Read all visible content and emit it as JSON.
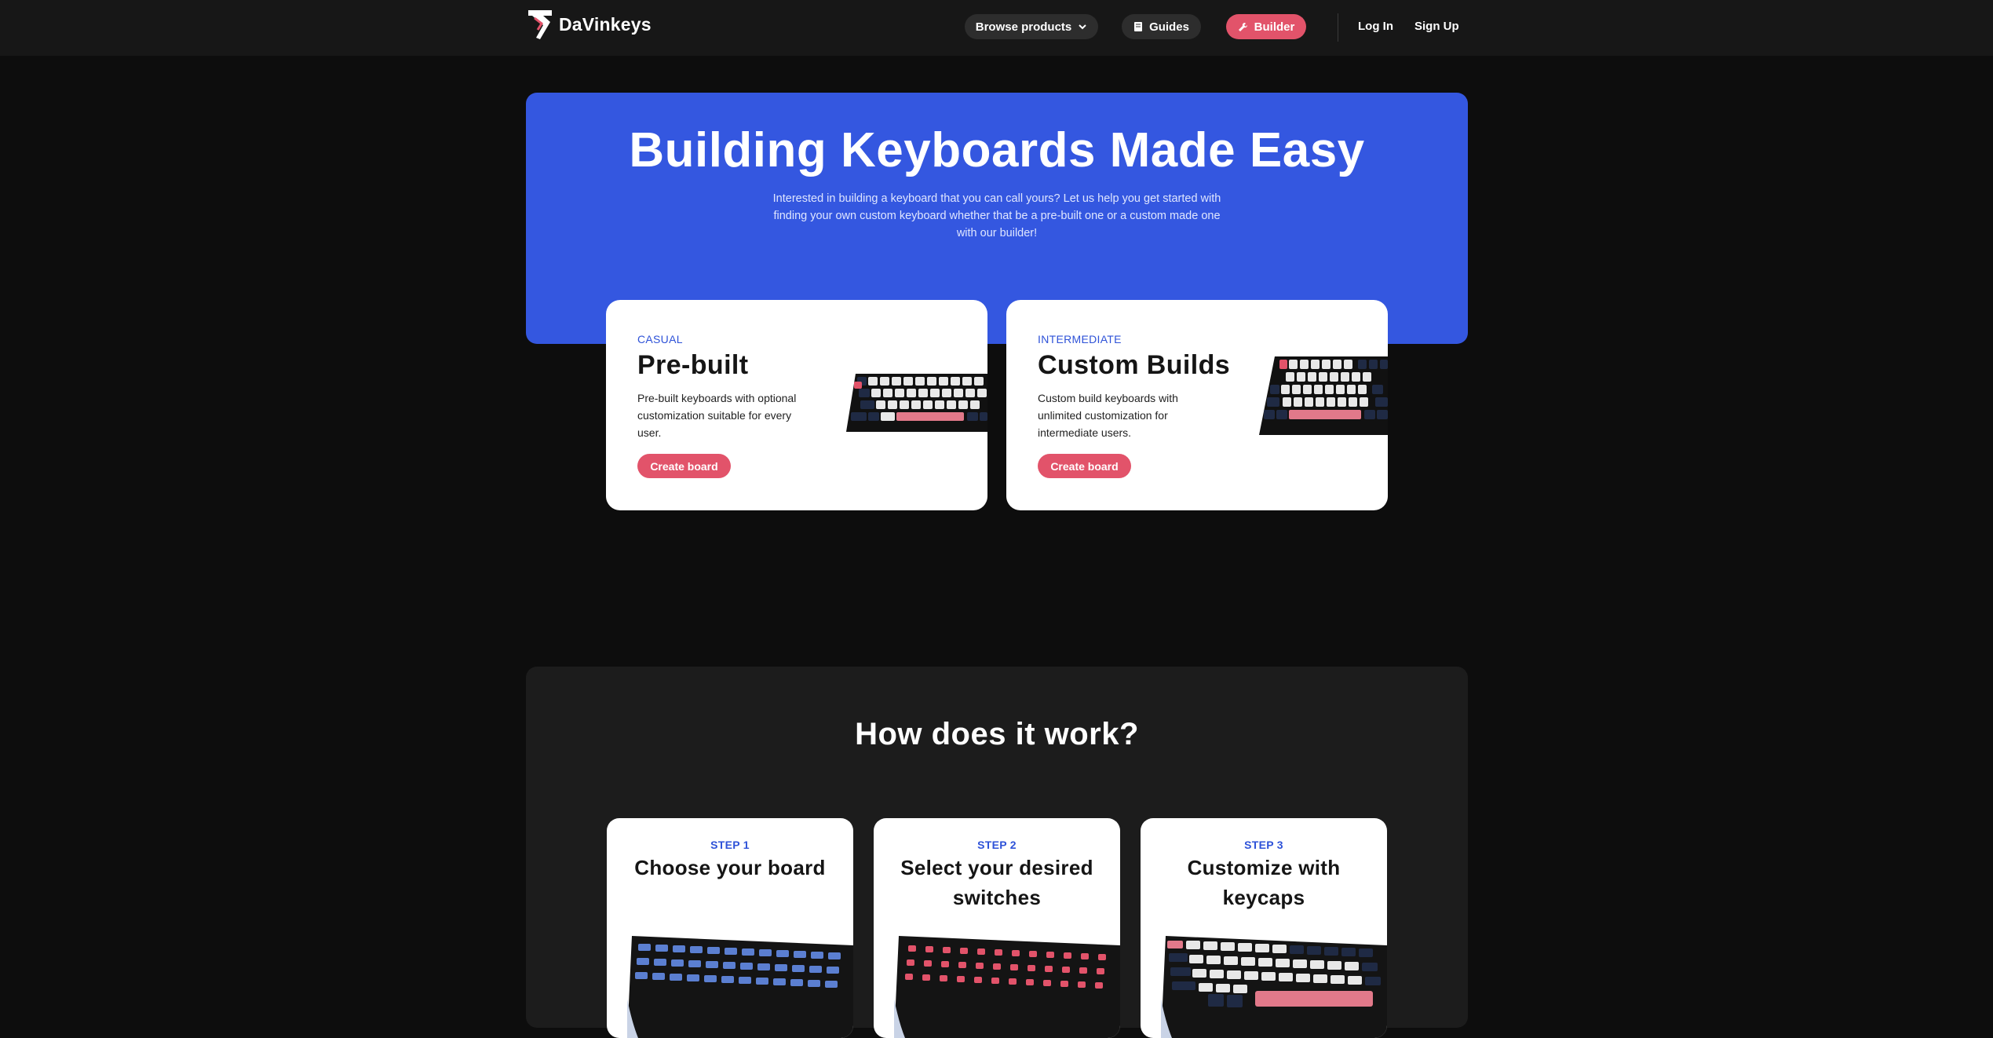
{
  "brand": {
    "name": "DaVinkeys"
  },
  "nav": {
    "browse_label": "Browse products",
    "guides_label": "Guides",
    "builder_label": "Builder",
    "login_label": "Log In",
    "signup_label": "Sign Up"
  },
  "hero": {
    "title": "Building Keyboards Made Easy",
    "subtitle": "Interested in building a keyboard that you can call yours? Let us help you get started with finding your own custom keyboard whether that be a pre-built one or a custom made one with our builder!"
  },
  "types": [
    {
      "tag": "CASUAL",
      "title": "Pre-built",
      "description": "Pre-built keyboards with optional customization suitable for every user.",
      "button": "Create board"
    },
    {
      "tag": "INTERMEDIATE",
      "title": "Custom Builds",
      "description": "Custom build keyboards with unlimited customization for intermediate users.",
      "button": "Create board"
    }
  ],
  "how": {
    "title": "How does it work?",
    "steps": [
      {
        "step": "STEP 1",
        "title": "Choose your board"
      },
      {
        "step": "STEP 2",
        "title": "Select your desired switches"
      },
      {
        "step": "STEP 3",
        "title": "Customize with keycaps"
      }
    ]
  },
  "colors": {
    "accent": "#e2536a",
    "hero_blue": "#3457e0",
    "tag_blue": "#2e52d8",
    "background": "#0d0d0d",
    "nav_bg": "#171717",
    "section_bg": "#1c1c1c"
  },
  "icons": {
    "logo": "davinkeys-logo-icon",
    "browse": "chevron-down-icon",
    "guides": "book-icon",
    "builder": "wrench-icon"
  }
}
